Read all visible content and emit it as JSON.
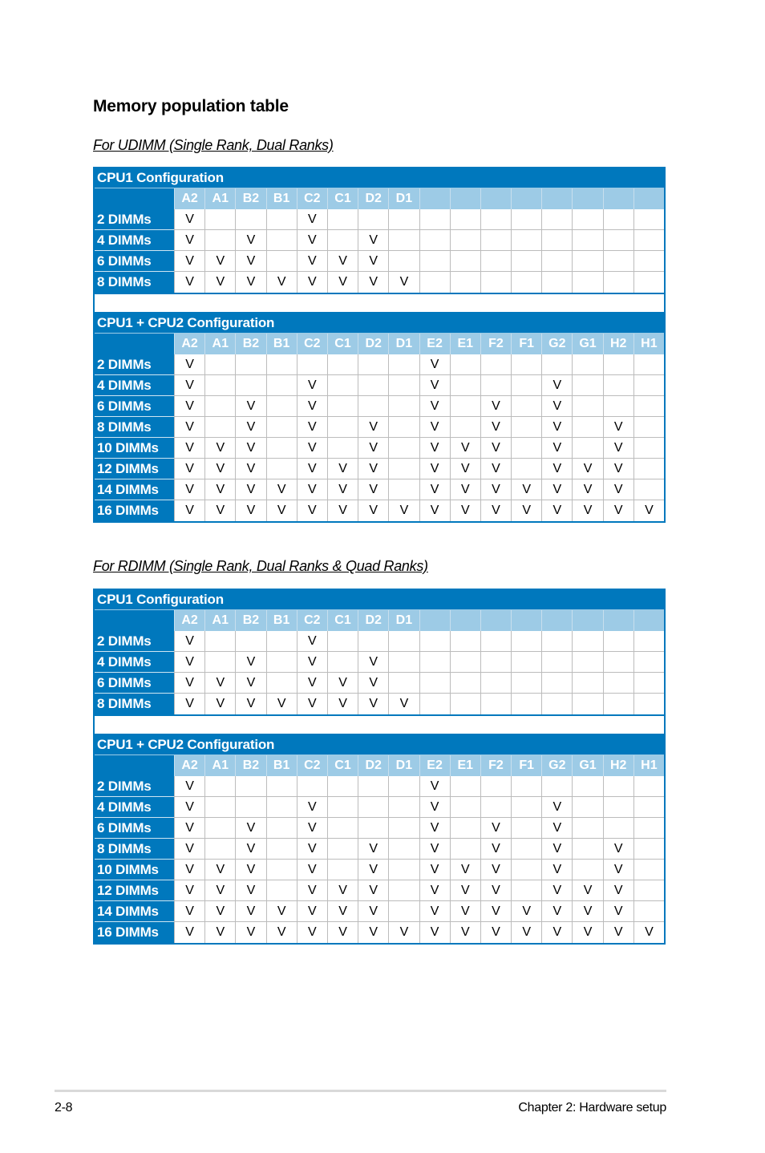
{
  "page_title": "Memory population table",
  "footer": {
    "page_number": "2-8",
    "chapter": "Chapter 2:  Hardware setup"
  },
  "colors": {
    "header_blue": "#0078bd",
    "slot_header_light_blue": "#9dcbe6"
  },
  "mark": "V",
  "sections": [
    {
      "subtitle": "For UDIMM (Single Rank, Dual Ranks)",
      "tables": [
        {
          "title": "CPU1 Configuration",
          "slots": [
            "A2",
            "A1",
            "B2",
            "B1",
            "C2",
            "C1",
            "D2",
            "D1",
            "",
            "",
            "",
            "",
            "",
            "",
            "",
            ""
          ],
          "rows": [
            {
              "label": "2 DIMMs",
              "cells": [
                "V",
                "",
                "",
                "",
                "V",
                "",
                "",
                "",
                "",
                "",
                "",
                "",
                "",
                "",
                "",
                ""
              ]
            },
            {
              "label": "4 DIMMs",
              "cells": [
                "V",
                "",
                "V",
                "",
                "V",
                "",
                "V",
                "",
                "",
                "",
                "",
                "",
                "",
                "",
                "",
                ""
              ]
            },
            {
              "label": "6 DIMMs",
              "cells": [
                "V",
                "V",
                "V",
                "",
                "V",
                "V",
                "V",
                "",
                "",
                "",
                "",
                "",
                "",
                "",
                "",
                ""
              ]
            },
            {
              "label": "8 DIMMs",
              "cells": [
                "V",
                "V",
                "V",
                "V",
                "V",
                "V",
                "V",
                "V",
                "",
                "",
                "",
                "",
                "",
                "",
                "",
                ""
              ]
            }
          ]
        },
        {
          "title": "CPU1 + CPU2 Configuration",
          "slots": [
            "A2",
            "A1",
            "B2",
            "B1",
            "C2",
            "C1",
            "D2",
            "D1",
            "E2",
            "E1",
            "F2",
            "F1",
            "G2",
            "G1",
            "H2",
            "H1"
          ],
          "rows": [
            {
              "label": "2 DIMMs",
              "cells": [
                "V",
                "",
                "",
                "",
                "",
                "",
                "",
                "",
                "V",
                "",
                "",
                "",
                "",
                "",
                "",
                ""
              ]
            },
            {
              "label": "4 DIMMs",
              "cells": [
                "V",
                "",
                "",
                "",
                "V",
                "",
                "",
                "",
                "V",
                "",
                "",
                "",
                "V",
                "",
                "",
                ""
              ]
            },
            {
              "label": "6 DIMMs",
              "cells": [
                "V",
                "",
                "V",
                "",
                "V",
                "",
                "",
                "",
                "V",
                "",
                "V",
                "",
                "V",
                "",
                "",
                ""
              ]
            },
            {
              "label": "8 DIMMs",
              "cells": [
                "V",
                "",
                "V",
                "",
                "V",
                "",
                "V",
                "",
                "V",
                "",
                "V",
                "",
                "V",
                "",
                "V",
                ""
              ]
            },
            {
              "label": "10 DIMMs",
              "cells": [
                "V",
                "V",
                "V",
                "",
                "V",
                "",
                "V",
                "",
                "V",
                "V",
                "V",
                "",
                "V",
                "",
                "V",
                ""
              ]
            },
            {
              "label": "12 DIMMs",
              "cells": [
                "V",
                "V",
                "V",
                "",
                "V",
                "V",
                "V",
                "",
                "V",
                "V",
                "V",
                "",
                "V",
                "V",
                "V",
                ""
              ]
            },
            {
              "label": "14 DIMMs",
              "cells": [
                "V",
                "V",
                "V",
                "V",
                "V",
                "V",
                "V",
                "",
                "V",
                "V",
                "V",
                "V",
                "V",
                "V",
                "V",
                ""
              ]
            },
            {
              "label": "16 DIMMs",
              "cells": [
                "V",
                "V",
                "V",
                "V",
                "V",
                "V",
                "V",
                "V",
                "V",
                "V",
                "V",
                "V",
                "V",
                "V",
                "V",
                "V"
              ]
            }
          ]
        }
      ]
    },
    {
      "subtitle": "For RDIMM (Single Rank, Dual Ranks & Quad Ranks)",
      "tables": [
        {
          "title": "CPU1 Configuration",
          "slots": [
            "A2",
            "A1",
            "B2",
            "B1",
            "C2",
            "C1",
            "D2",
            "D1",
            "",
            "",
            "",
            "",
            "",
            "",
            "",
            ""
          ],
          "rows": [
            {
              "label": "2 DIMMs",
              "cells": [
                "V",
                "",
                "",
                "",
                "V",
                "",
                "",
                "",
                "",
                "",
                "",
                "",
                "",
                "",
                "",
                ""
              ]
            },
            {
              "label": "4 DIMMs",
              "cells": [
                "V",
                "",
                "V",
                "",
                "V",
                "",
                "V",
                "",
                "",
                "",
                "",
                "",
                "",
                "",
                "",
                ""
              ]
            },
            {
              "label": "6 DIMMs",
              "cells": [
                "V",
                "V",
                "V",
                "",
                "V",
                "V",
                "V",
                "",
                "",
                "",
                "",
                "",
                "",
                "",
                "",
                ""
              ]
            },
            {
              "label": "8 DIMMs",
              "cells": [
                "V",
                "V",
                "V",
                "V",
                "V",
                "V",
                "V",
                "V",
                "",
                "",
                "",
                "",
                "",
                "",
                "",
                ""
              ]
            }
          ]
        },
        {
          "title": "CPU1 + CPU2 Configuration",
          "slots": [
            "A2",
            "A1",
            "B2",
            "B1",
            "C2",
            "C1",
            "D2",
            "D1",
            "E2",
            "E1",
            "F2",
            "F1",
            "G2",
            "G1",
            "H2",
            "H1"
          ],
          "rows": [
            {
              "label": "2 DIMMs",
              "cells": [
                "V",
                "",
                "",
                "",
                "",
                "",
                "",
                "",
                "V",
                "",
                "",
                "",
                "",
                "",
                "",
                ""
              ]
            },
            {
              "label": "4 DIMMs",
              "cells": [
                "V",
                "",
                "",
                "",
                "V",
                "",
                "",
                "",
                "V",
                "",
                "",
                "",
                "V",
                "",
                "",
                ""
              ]
            },
            {
              "label": "6 DIMMs",
              "cells": [
                "V",
                "",
                "V",
                "",
                "V",
                "",
                "",
                "",
                "V",
                "",
                "V",
                "",
                "V",
                "",
                "",
                ""
              ]
            },
            {
              "label": "8 DIMMs",
              "cells": [
                "V",
                "",
                "V",
                "",
                "V",
                "",
                "V",
                "",
                "V",
                "",
                "V",
                "",
                "V",
                "",
                "V",
                ""
              ]
            },
            {
              "label": "10 DIMMs",
              "cells": [
                "V",
                "V",
                "V",
                "",
                "V",
                "",
                "V",
                "",
                "V",
                "V",
                "V",
                "",
                "V",
                "",
                "V",
                ""
              ]
            },
            {
              "label": "12 DIMMs",
              "cells": [
                "V",
                "V",
                "V",
                "",
                "V",
                "V",
                "V",
                "",
                "V",
                "V",
                "V",
                "",
                "V",
                "V",
                "V",
                ""
              ]
            },
            {
              "label": "14 DIMMs",
              "cells": [
                "V",
                "V",
                "V",
                "V",
                "V",
                "V",
                "V",
                "",
                "V",
                "V",
                "V",
                "V",
                "V",
                "V",
                "V",
                ""
              ]
            },
            {
              "label": "16 DIMMs",
              "cells": [
                "V",
                "V",
                "V",
                "V",
                "V",
                "V",
                "V",
                "V",
                "V",
                "V",
                "V",
                "V",
                "V",
                "V",
                "V",
                "V"
              ]
            }
          ]
        }
      ]
    }
  ]
}
